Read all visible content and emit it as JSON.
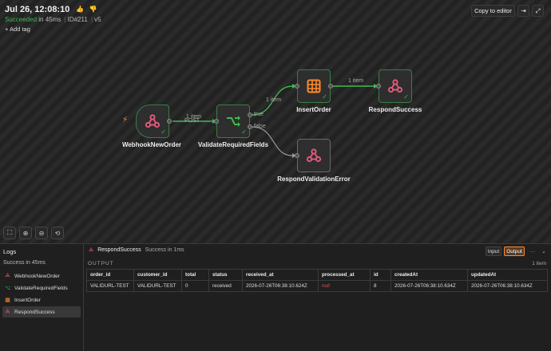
{
  "header": {
    "title": "Jul 26, 12:08:10",
    "status_word": "Succeeded",
    "status_rest": "in 45ms",
    "id_text": "ID#211",
    "version": "v5",
    "add_tag": "+ Add tag",
    "copy_button": "Copy to editor"
  },
  "workflow": {
    "nodes": [
      {
        "label": "WebhookNewOrder",
        "icon": "webhook-icon"
      },
      {
        "label": "ValidateRequiredFields",
        "icon": "if-branch-icon"
      },
      {
        "label": "InsertOrder",
        "icon": "table-icon"
      },
      {
        "label": "RespondSuccess",
        "icon": "webhook-icon"
      },
      {
        "label": "RespondValidationError",
        "icon": "webhook-icon"
      }
    ],
    "edges": {
      "webhook_items": "1 item",
      "webhook_method": "POST",
      "true_items": "1 item",
      "insert_items": "1 item",
      "true_label": "true",
      "false_label": "false"
    }
  },
  "logs": {
    "title": "Logs",
    "status": "Success in 45ms",
    "items": [
      {
        "label": "WebhookNewOrder",
        "icon": "webhook-icon"
      },
      {
        "label": "ValidateRequiredFields",
        "icon": "if-branch-icon"
      },
      {
        "label": "InsertOrder",
        "icon": "table-icon"
      },
      {
        "label": "RespondSuccess",
        "icon": "webhook-icon"
      }
    ]
  },
  "panel": {
    "node_name": "RespondSuccess",
    "node_status": "Success in 1ms",
    "input_tab": "Input",
    "output_tab": "Output",
    "more": "···",
    "output_label": "OUTPUT",
    "item_count": "1 item",
    "columns": [
      "order_id",
      "customer_id",
      "total",
      "status",
      "received_at",
      "processed_at",
      "id",
      "createdAt",
      "updatedAt"
    ],
    "rows": [
      [
        "VALIDURL-TEST",
        "VALIDURL-TEST",
        "0",
        "received",
        "2026-07-26T06:38:10.624Z",
        "null",
        "8",
        "2026-07-26T06:38:10.634Z",
        "2026-07-26T06:38:10.634Z"
      ]
    ]
  },
  "colors": {
    "accent": "#ff6f5c",
    "success": "#3fb950",
    "webhook": "#e05a7a",
    "table": "#ff8a2a"
  }
}
